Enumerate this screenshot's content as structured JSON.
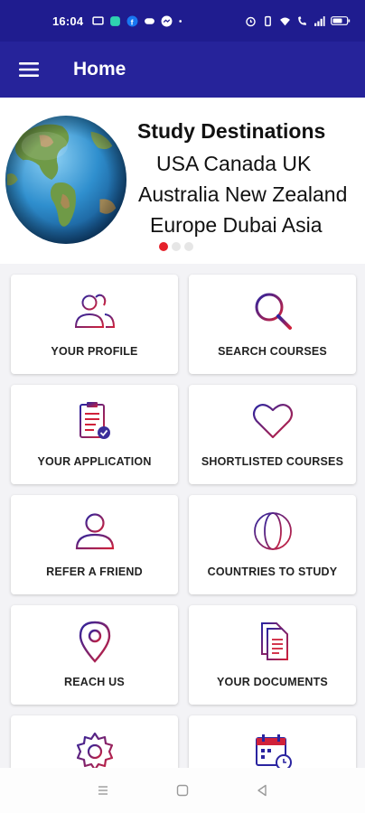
{
  "status_bar": {
    "time": "16:04",
    "bg_color": "#1f1c8f",
    "left_icons": [
      "message-icon",
      "app-icon",
      "facebook-icon",
      "game-icon",
      "messenger-icon",
      "dot-icon"
    ],
    "right_icons": [
      "alarm-icon",
      "vibrate-icon",
      "wifi-icon",
      "call-icon",
      "signal-icon",
      "battery-icon"
    ]
  },
  "app_bar": {
    "title": "Home",
    "bg_color": "#26239a",
    "menu_icon": "hamburger-menu-icon"
  },
  "banner": {
    "title": "Study Destinations",
    "lines": [
      "USA Canada UK",
      "Australia New Zealand",
      "Europe Dubai Asia"
    ],
    "image": "globe-image",
    "carousel_active_index": 0,
    "carousel_count": 3,
    "active_dot_color": "#e5212b"
  },
  "grid": {
    "items": [
      {
        "label": "YOUR PROFILE",
        "icon": "users-icon"
      },
      {
        "label": "SEARCH COURSES",
        "icon": "search-icon"
      },
      {
        "label": "YOUR APPLICATION",
        "icon": "application-clipboard-icon"
      },
      {
        "label": "SHORTLISTED COURSES",
        "icon": "heart-icon"
      },
      {
        "label": "REFER A FRIEND",
        "icon": "user-icon"
      },
      {
        "label": "COUNTRIES TO STUDY",
        "icon": "globe-icon"
      },
      {
        "label": "REACH US",
        "icon": "location-pin-icon"
      },
      {
        "label": "YOUR DOCUMENTS",
        "icon": "documents-icon"
      },
      {
        "label": "",
        "icon": "settings-icon"
      },
      {
        "label": "",
        "icon": "calendar-icon"
      }
    ],
    "icon_gradient": [
      "#2a24a0",
      "#d0213a"
    ]
  },
  "system_nav": {
    "buttons": [
      "menu-icon",
      "home-square-icon",
      "back-triangle-icon"
    ]
  }
}
